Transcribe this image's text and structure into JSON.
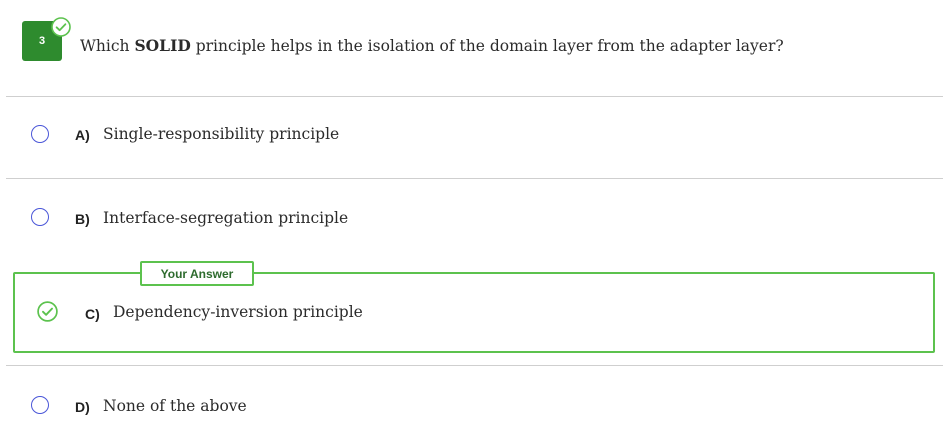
{
  "question": {
    "number": "3",
    "text_before": "Which ",
    "text_bold": "SOLID",
    "text_after": " principle helps in the isolation of the domain layer from the adapter layer?",
    "status_icon": "check-circle-icon"
  },
  "answer_badge": "Your Answer",
  "options": [
    {
      "letter": "A)",
      "text": "Single-responsibility principle",
      "selected": false
    },
    {
      "letter": "B)",
      "text": "Interface-segregation principle",
      "selected": false
    },
    {
      "letter": "C)",
      "text": "Dependency-inversion principle",
      "selected": true
    },
    {
      "letter": "D)",
      "text": "None of the above",
      "selected": false
    }
  ],
  "colors": {
    "correct_green": "#5cc24e",
    "number_badge_green": "#2e8b2e",
    "radio_blue": "#4a56d8"
  }
}
